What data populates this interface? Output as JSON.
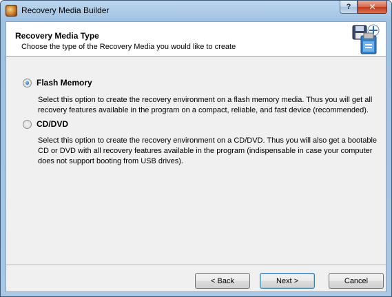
{
  "window": {
    "title": "Recovery Media Builder",
    "help_label": "?",
    "close_label": "✕"
  },
  "header": {
    "title": "Recovery Media Type",
    "subtitle": "Choose the type of the Recovery Media you would like to create"
  },
  "options": [
    {
      "label": "Flash Memory",
      "selected": true,
      "description": "Select this option to create the recovery environment on a flash memory media. Thus you will get all recovery features available in the program on a compact, reliable, and fast device (recommended)."
    },
    {
      "label": "CD/DVD",
      "selected": false,
      "description": "Select this option to create the recovery environment on a CD/DVD. Thus you will also get a bootable CD or DVD with all recovery features available in the program (indispensable in case your computer does not support booting from USB drives)."
    }
  ],
  "buttons": {
    "back": "< Back",
    "next": "Next >",
    "cancel": "Cancel"
  },
  "icons": {
    "app": "app-icon",
    "header": "floppy-disk-usb-icon"
  }
}
